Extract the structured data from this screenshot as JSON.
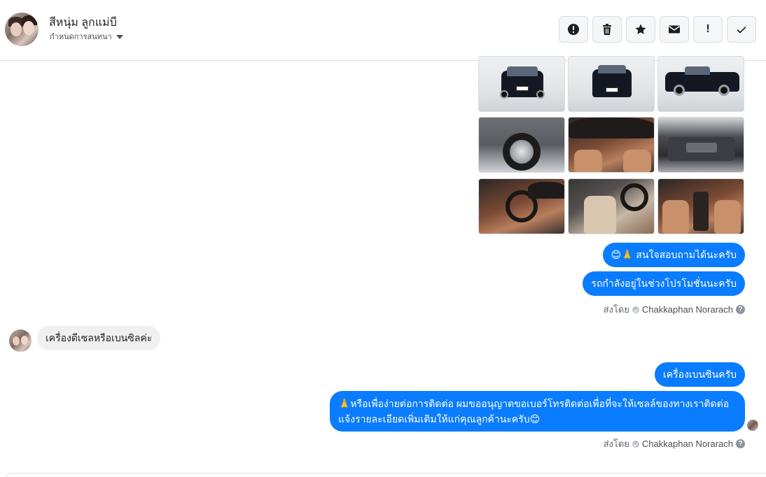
{
  "header": {
    "contact_name": "สีหนุ่ม ลูกแม่บี",
    "assign_label": "กำหนดการสนทนา",
    "toolbar": [
      {
        "name": "report-spam-button",
        "icon": "alert-circle-icon",
        "label": ""
      },
      {
        "name": "delete-button",
        "icon": "trash-icon",
        "label": ""
      },
      {
        "name": "star-button",
        "icon": "star-icon",
        "label": ""
      },
      {
        "name": "mark-unread-button",
        "icon": "envelope-icon",
        "label": ""
      },
      {
        "name": "follow-up-button",
        "icon": "exclamation-icon",
        "label": "!"
      },
      {
        "name": "mark-done-button",
        "icon": "checkmark-icon",
        "label": ""
      }
    ]
  },
  "images": {
    "count": 9,
    "descriptions": [
      "car-front",
      "car-rear",
      "car-side",
      "car-wheel-closeup",
      "dashboard",
      "engine-bay",
      "interior-driver",
      "interior-seats",
      "interior-console"
    ]
  },
  "messages": {
    "m1": "😊🙏 สนใจสอบถามได้นะครับ",
    "m2": "รถกำลังอยู่ในช่วงโปรโมชั่นนะครับ",
    "sent_by_prefix": "ส่งโดย",
    "sent_by_name": "Chakkaphan Norarach",
    "help_glyph": "?",
    "incoming_1": "เครื่องดีเซลหรือเบนซิลค่ะ",
    "m3": "เครื่องเบนซินครับ",
    "m4": "🙏หรือเพื่อง่ายต่อการติดต่อ ผมขออนุญาตขอเบอร์โทรติดต่อเพื่อที่จะให้เซลล์ของทางเราติดต่อแจ้งรายละเอียดเพิ่มเติมให้แก่คุณลูกค้านะครับ😊",
    "sent_by_prefix_2": "ส่งโดย",
    "sent_by_name_2": "Chakkaphan Norarach",
    "help_glyph_2": "?"
  },
  "colors": {
    "outgoing_bubble": "#0a7cff",
    "incoming_bubble": "#f0f0f0"
  }
}
